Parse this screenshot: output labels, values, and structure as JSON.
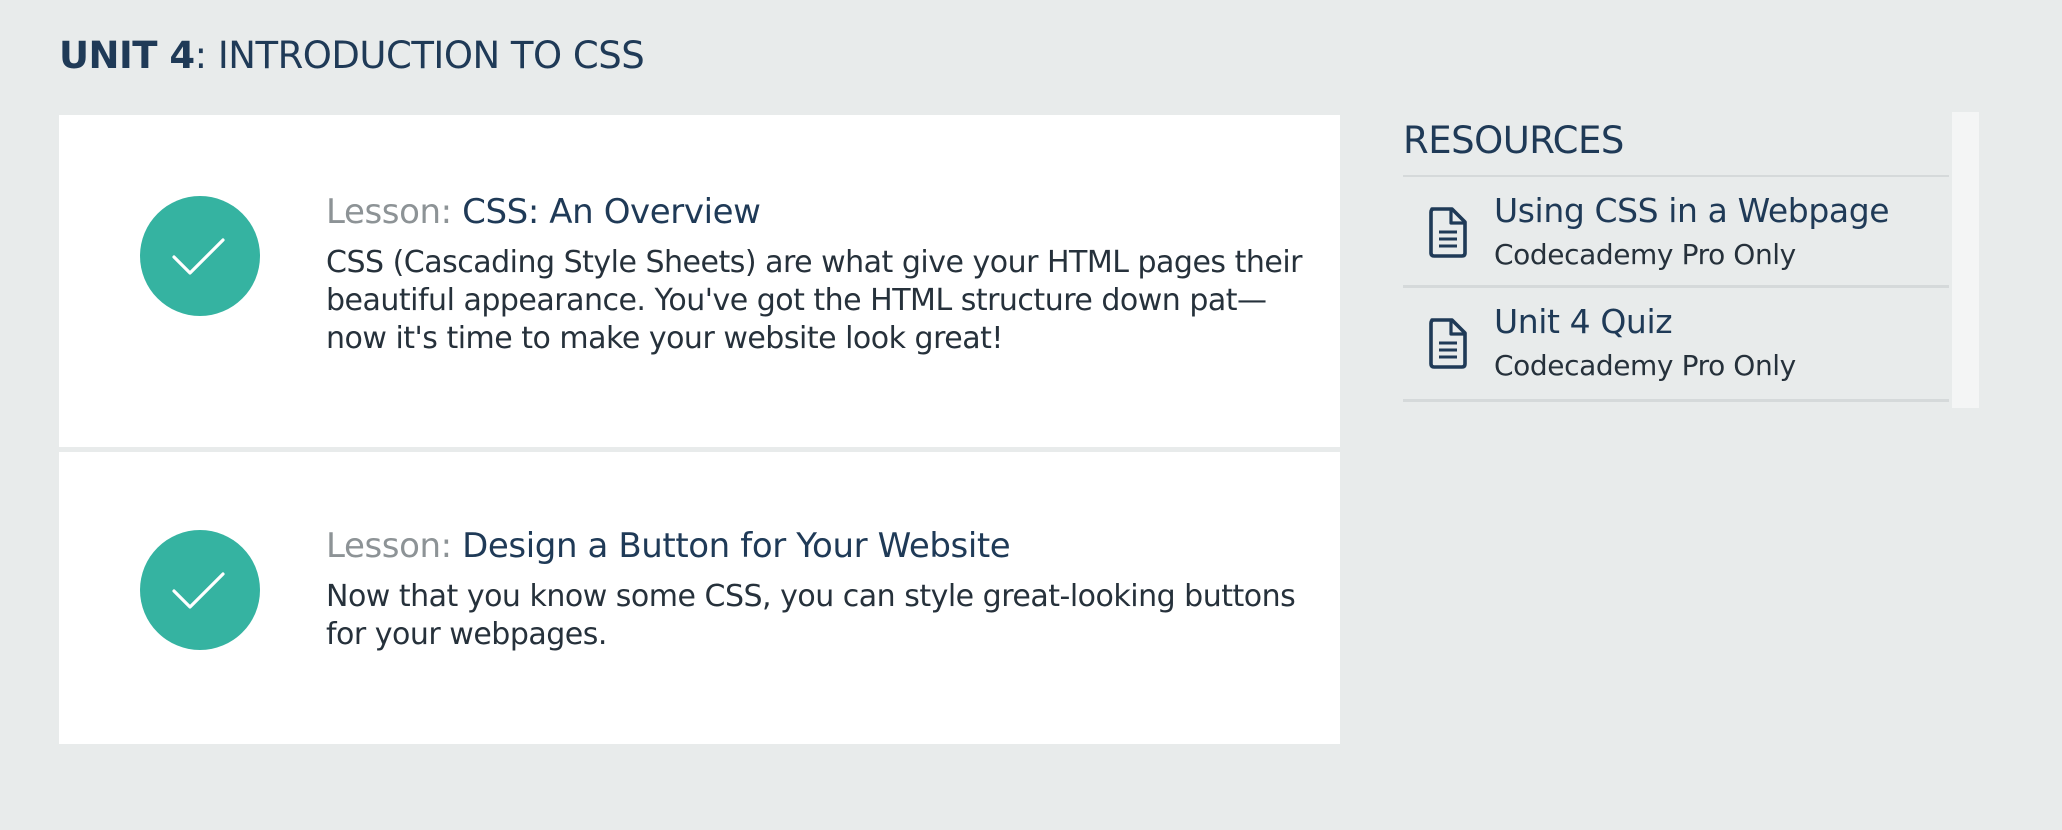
{
  "unit": {
    "number_label": "UNIT 4",
    "separator": ": ",
    "name": "INTRODUCTION TO CSS"
  },
  "lessons": [
    {
      "prefix": "Lesson: ",
      "title": "CSS: An Overview",
      "description_lines": [
        "CSS (Cascading Style Sheets) are what give your HTML pages their",
        "beautiful appearance. You've got the HTML structure down pat—",
        "now it's time to make your website look great!"
      ],
      "status": "completed",
      "status_icon": "check-icon"
    },
    {
      "prefix": "Lesson: ",
      "title": "Design a Button for Your Website",
      "description_lines": [
        "Now that you know some CSS, you can style great-looking buttons",
        "for your webpages."
      ],
      "status": "completed",
      "status_icon": "check-icon"
    }
  ],
  "resources": {
    "heading": "RESOURCES",
    "items": [
      {
        "title": "Using CSS in a Webpage",
        "subtitle": "Codecademy Pro Only",
        "icon": "document-icon"
      },
      {
        "title": "Unit 4 Quiz",
        "subtitle": "Codecademy Pro Only",
        "icon": "document-icon"
      }
    ]
  },
  "colors": {
    "page_background": "#e8ebeb",
    "card_background": "#ffffff",
    "completed_accent": "#35b3a1",
    "heading_text": "#1f3a57",
    "muted_text": "#8d9396"
  }
}
